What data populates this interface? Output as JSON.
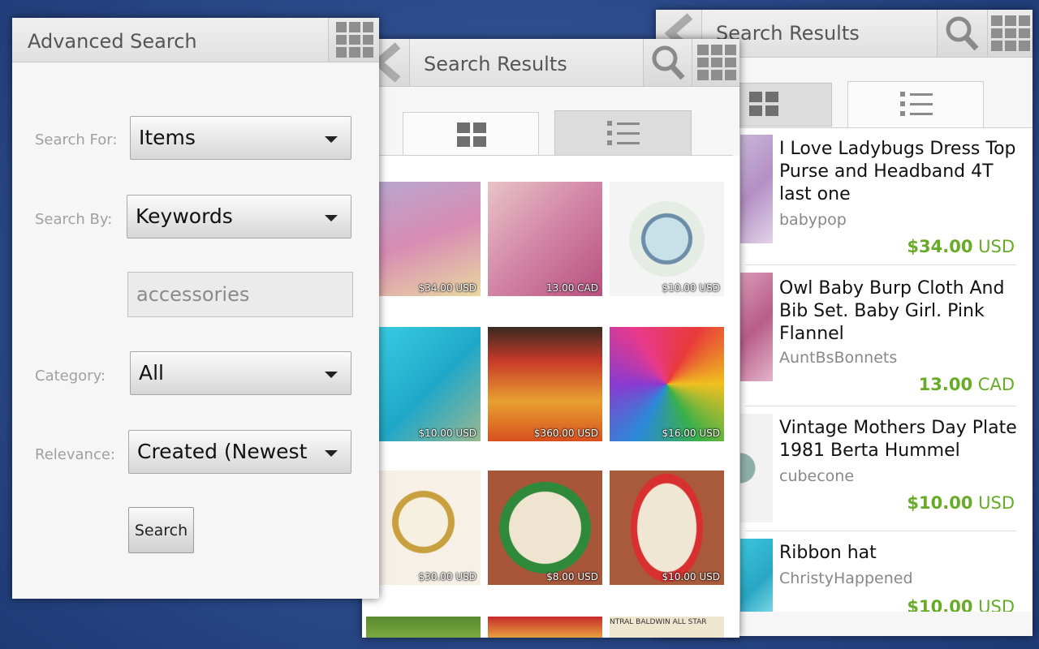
{
  "colors": {
    "price_green": "#67ab28",
    "background": "#2d4c8c"
  },
  "advanced_search": {
    "title": "Advanced Search",
    "fields": {
      "search_for": {
        "label": "Search For:",
        "value": "Items"
      },
      "search_by": {
        "label": "Search By:",
        "value": "Keywords"
      },
      "keywords": {
        "value": "accessories",
        "placeholder": "accessories"
      },
      "category": {
        "label": "Category:",
        "value": "All"
      },
      "relevance": {
        "label": "Relevance:",
        "value": "Created (Newest"
      }
    },
    "search_button": "Search"
  },
  "grid_results": {
    "title": "Search Results",
    "items": [
      {
        "price": "$34.00 USD",
        "icon": "girl-dress-photo"
      },
      {
        "price": "13.00 CAD",
        "icon": "pink-bib-photo"
      },
      {
        "price": "$10.00 USD",
        "icon": "plate-photo"
      },
      {
        "price": "$10.00 USD",
        "icon": "ribbon-hat-photo"
      },
      {
        "price": "$360.00 USD",
        "icon": "dress-photo"
      },
      {
        "price": "$16.00 USD",
        "icon": "tie-dye-photo"
      },
      {
        "price": "$30.00 USD",
        "icon": "bracelet-photo"
      },
      {
        "price": "$8.00 USD",
        "icon": "patch-photo"
      },
      {
        "price": "$10.00 USD",
        "icon": "patch-photo"
      }
    ],
    "partial_row_text": "NTRAL BALDWIN ALL STAR"
  },
  "list_results": {
    "title": "Search Results",
    "items": [
      {
        "title": "I Love Ladybugs Dress Top Purse and Headband 4T last one",
        "seller": "babypop",
        "amount": "$34.00",
        "currency": "USD"
      },
      {
        "title": "Owl Baby Burp Cloth And Bib Set. Baby Girl. Pink Flannel",
        "seller": "AuntBsBonnets",
        "amount": "13.00",
        "currency": "CAD"
      },
      {
        "title": "Vintage Mothers Day Plate 1981 Berta Hummel",
        "seller": "cubecone",
        "amount": "$10.00",
        "currency": "USD"
      },
      {
        "title": "Ribbon hat",
        "seller": "ChristyHappened",
        "amount": "$10.00",
        "currency": "USD"
      }
    ]
  }
}
